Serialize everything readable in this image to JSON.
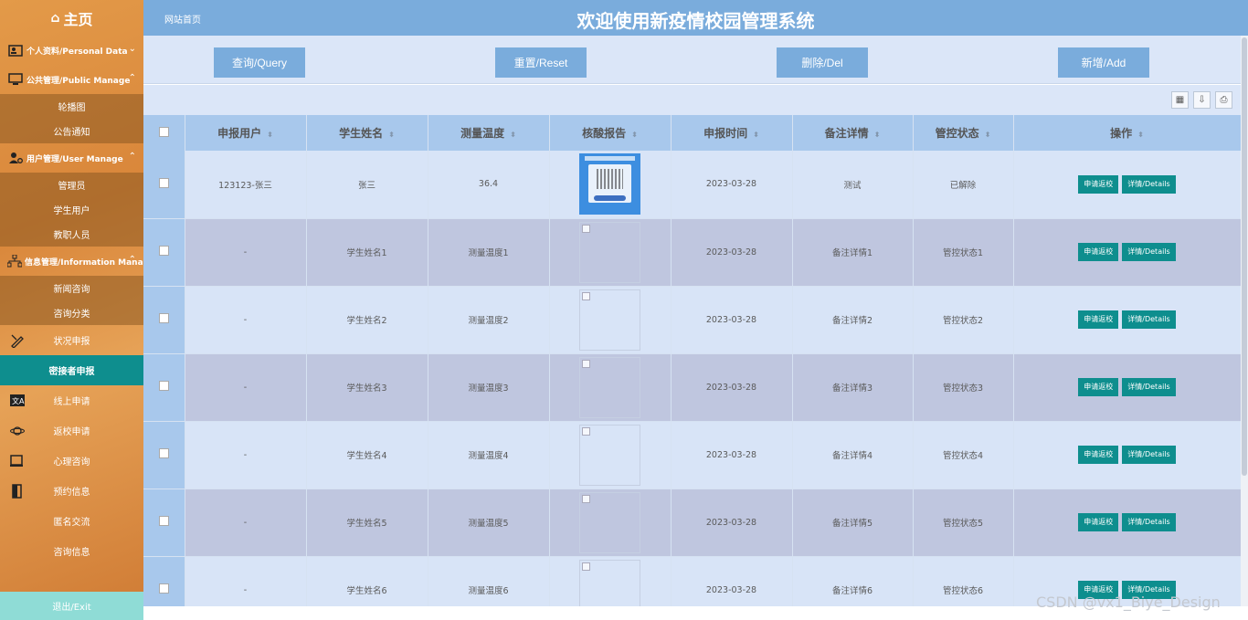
{
  "sidebar": {
    "home": "主页",
    "personal": "个人资料/Personal Data",
    "public_manage": "公共管理/Public Manage",
    "public_items": [
      "轮播图",
      "公告通知"
    ],
    "user_manage": "用户管理/User Manage",
    "user_items": [
      "管理员",
      "学生用户",
      "教职人员"
    ],
    "info_manage": "信息管理/Information Manage",
    "info_items": [
      "新闻咨询",
      "咨询分类"
    ],
    "items": [
      "状况申报",
      "密接者申报",
      "线上申请",
      "返校申请",
      "心理咨询",
      "预约信息",
      "匿名交流",
      "咨询信息"
    ],
    "exit": "退出/Exit"
  },
  "header": {
    "breadcrumb": "网站首页",
    "title": "欢迎使用新疫情校园管理系统"
  },
  "toolbar": {
    "query": "查询/Query",
    "reset": "重置/Reset",
    "delete": "删除/Del",
    "add": "新增/Add"
  },
  "table": {
    "headers": [
      "申报用户",
      "学生姓名",
      "测量温度",
      "核酸报告",
      "申报时间",
      "备注详情",
      "管控状态",
      "操作"
    ],
    "rows": [
      [
        "123123-张三",
        "张三",
        "36.4",
        "",
        "2023-03-28",
        "测试",
        "已解除"
      ],
      [
        "-",
        "学生姓名1",
        "测量温度1",
        "",
        "2023-03-28",
        "备注详情1",
        "管控状态1"
      ],
      [
        "-",
        "学生姓名2",
        "测量温度2",
        "",
        "2023-03-28",
        "备注详情2",
        "管控状态2"
      ],
      [
        "-",
        "学生姓名3",
        "测量温度3",
        "",
        "2023-03-28",
        "备注详情3",
        "管控状态3"
      ],
      [
        "-",
        "学生姓名4",
        "测量温度4",
        "",
        "2023-03-28",
        "备注详情4",
        "管控状态4"
      ],
      [
        "-",
        "学生姓名5",
        "测量温度5",
        "",
        "2023-03-28",
        "备注详情5",
        "管控状态5"
      ],
      [
        "-",
        "学生姓名6",
        "测量温度6",
        "",
        "2023-03-28",
        "备注详情6",
        "管控状态6"
      ]
    ],
    "action_apply": "申请返校",
    "action_details": "详情/Details"
  },
  "watermark": "CSDN @vx1_Biye_Design",
  "colors": {
    "header": "#7aacdc",
    "teal": "#0e8e8e",
    "sidebar": "#e39a49"
  }
}
